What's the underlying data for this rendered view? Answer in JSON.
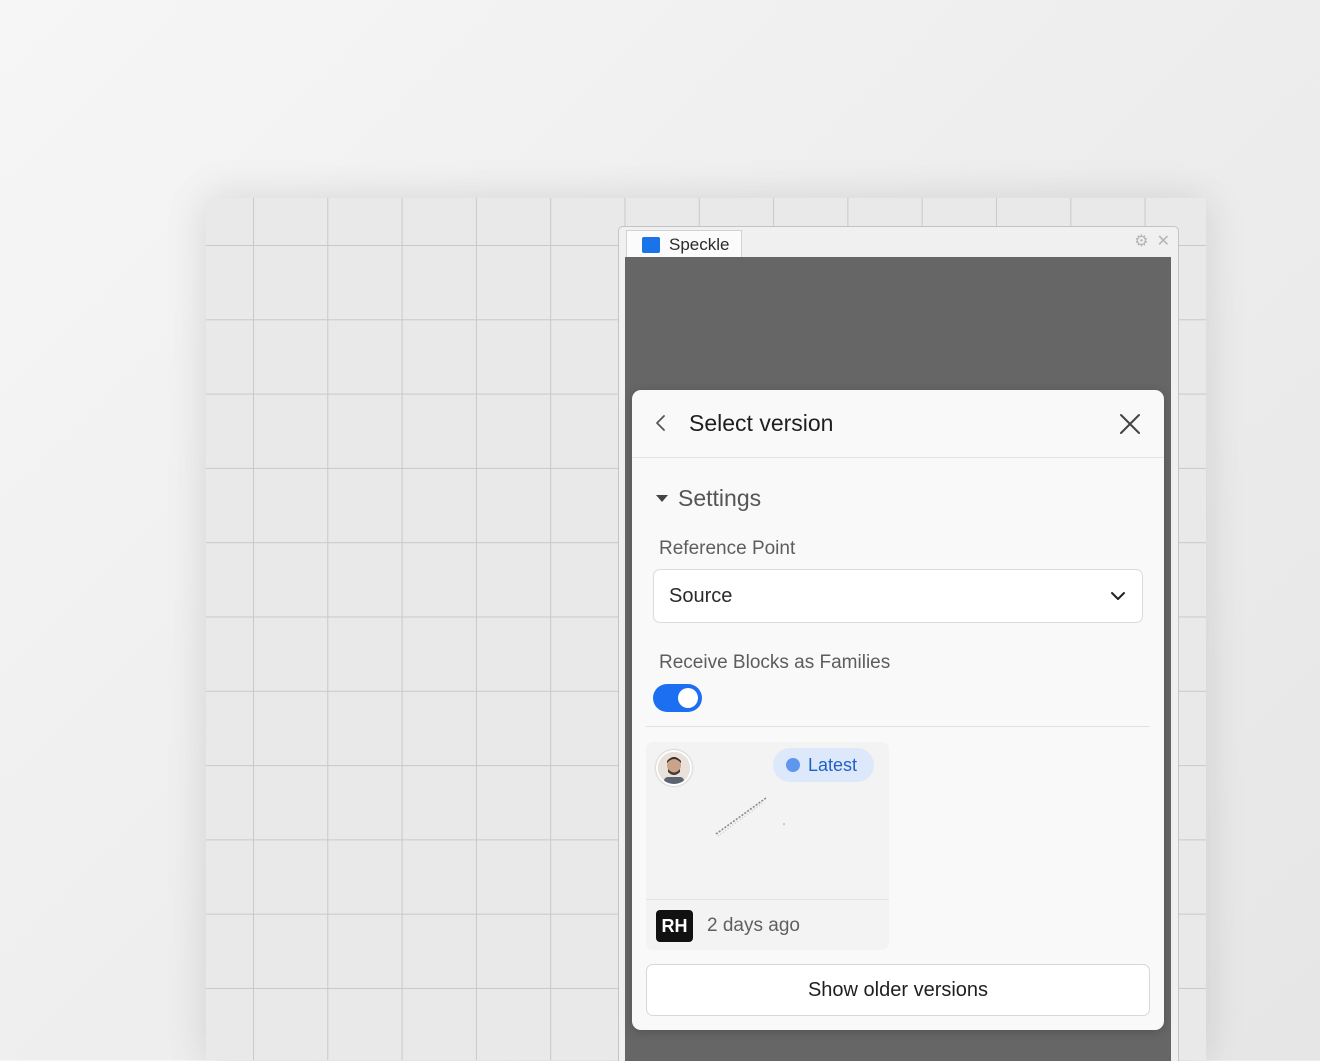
{
  "window": {
    "tab_title": "Speckle",
    "icons": {
      "logo": "speckle-logo-icon",
      "settings": "gear-icon",
      "close": "close-icon"
    }
  },
  "dialog": {
    "title": "Select version",
    "back_icon": "chevron-left-icon",
    "close_icon": "close-icon",
    "settings": {
      "label": "Settings",
      "expanded": true,
      "reference_point": {
        "label": "Reference Point",
        "value": "Source"
      },
      "receive_blocks": {
        "label": "Receive Blocks as Families",
        "enabled": true
      }
    },
    "versions": [
      {
        "badge": "Latest",
        "author_initials": "RH",
        "time_ago": "2 days ago"
      }
    ],
    "older_button": "Show older versions"
  },
  "colors": {
    "accent": "#1d6ff2",
    "latest_badge_bg": "#dde9fb",
    "panel_bg": "#666666"
  }
}
